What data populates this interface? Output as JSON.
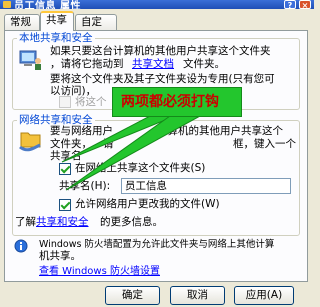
{
  "window": {
    "title": "员工信息 属性"
  },
  "tabs": [
    "常规",
    "共享",
    "自定义"
  ],
  "local": {
    "legend": "本地共享和安全",
    "line1": "如果只要这台计算机的其他用户共享这个文件夹",
    "line2_pre": "，请将它拖动到",
    "line2_link": "共享文档",
    "line2_post": "文件夹。",
    "line3": "要将这个文件夹及其子文件夹设为专用(只有您可",
    "line4": "以访问)，",
    "private_label": "将这个"
  },
  "network": {
    "legend": "网络共享和安全",
    "line1": "要与网络用户",
    "line1b": "计算机的其他用户共享这个",
    "line2": "文件夹，",
    "line2b": "请",
    "line2c": "框，键入一个",
    "line3": "共享名",
    "share_label": "在网络上共享这个文件夹(S)",
    "share_name_label": "共享名(H):",
    "share_name_value": "员工信息",
    "allow_label": "允许网络用户更改我的文件(W)",
    "learn_pre": "了解",
    "learn_link": "共享和安全",
    "learn_post": "的更多信息。"
  },
  "firewall": {
    "line1": "Windows 防火墙配置为允许此文件夹与网络上其他计算",
    "line2": "机共享。",
    "link": "查看 Windows 防火墙设置"
  },
  "callout": {
    "text": "两项都必须打钩"
  },
  "buttons": {
    "ok": "确定",
    "cancel": "取消",
    "apply": "应用(A)"
  },
  "state": {
    "share_checked": true,
    "allow_checked": true,
    "private_checked": false
  }
}
